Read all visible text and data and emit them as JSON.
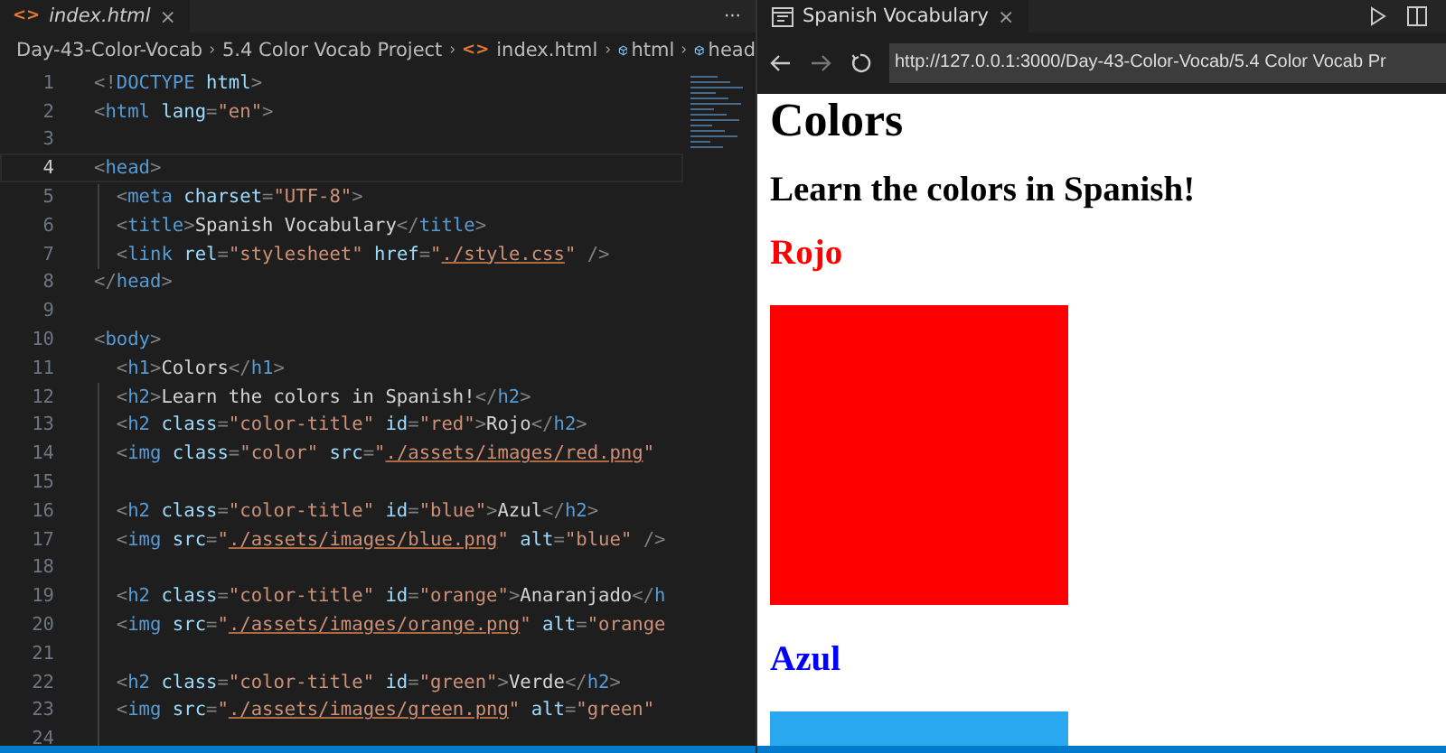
{
  "editor": {
    "tab": {
      "label": "index.html",
      "icon": "<>",
      "close": "×"
    },
    "more": "···",
    "breadcrumbs": [
      {
        "label": "Day-43-Color-Vocab",
        "kind": "folder"
      },
      {
        "label": "5.4 Color Vocab Project",
        "kind": "folder"
      },
      {
        "label": "index.html",
        "kind": "file"
      },
      {
        "label": "html",
        "kind": "element"
      },
      {
        "label": "head",
        "kind": "element"
      }
    ],
    "lines": [
      {
        "num": "1",
        "current": false,
        "tokens": [
          {
            "kind": "punct",
            "t": "<!"
          },
          {
            "kind": "tag",
            "t": "DOCTYPE"
          },
          {
            "kind": "attr",
            "t": " html"
          },
          {
            "kind": "punct",
            "t": ">"
          }
        ]
      },
      {
        "num": "2",
        "current": false,
        "tokens": [
          {
            "kind": "punct",
            "t": "<"
          },
          {
            "kind": "tag",
            "t": "html"
          },
          {
            "kind": "attr",
            "t": " lang"
          },
          {
            "kind": "punct",
            "t": "="
          },
          {
            "kind": "str",
            "t": "\"en\""
          },
          {
            "kind": "punct",
            "t": ">"
          }
        ]
      },
      {
        "num": "3",
        "current": false
      },
      {
        "num": "4",
        "current": true,
        "tokens": [
          {
            "kind": "punct",
            "t": "<"
          },
          {
            "kind": "tag",
            "t": "head"
          },
          {
            "kind": "punct",
            "t": ">"
          }
        ]
      },
      {
        "num": "5",
        "current": false,
        "tokens": [
          {
            "kind": "punct",
            "t": "  <"
          },
          {
            "kind": "tag",
            "t": "meta"
          },
          {
            "kind": "attr",
            "t": " charset"
          },
          {
            "kind": "punct",
            "t": "="
          },
          {
            "kind": "str",
            "t": "\"UTF-8\""
          },
          {
            "kind": "punct",
            "t": ">"
          }
        ]
      },
      {
        "num": "6",
        "current": false,
        "tokens": [
          {
            "kind": "punct",
            "t": "  <"
          },
          {
            "kind": "tag",
            "t": "title"
          },
          {
            "kind": "punct",
            "t": ">"
          },
          {
            "kind": "text",
            "t": "Spanish Vocabulary"
          },
          {
            "kind": "punct",
            "t": "</"
          },
          {
            "kind": "tag",
            "t": "title"
          },
          {
            "kind": "punct",
            "t": ">"
          }
        ]
      },
      {
        "num": "7",
        "current": false,
        "tokens": [
          {
            "kind": "punct",
            "t": "  <"
          },
          {
            "kind": "tag",
            "t": "link"
          },
          {
            "kind": "attr",
            "t": " rel"
          },
          {
            "kind": "punct",
            "t": "="
          },
          {
            "kind": "str",
            "t": "\"stylesheet\""
          },
          {
            "kind": "attr",
            "t": " href"
          },
          {
            "kind": "punct",
            "t": "="
          },
          {
            "kind": "str",
            "t": "\""
          },
          {
            "kind": "link",
            "t": "./style.css"
          },
          {
            "kind": "str",
            "t": "\""
          },
          {
            "kind": "punct",
            "t": " />"
          }
        ]
      },
      {
        "num": "8",
        "current": false,
        "tokens": [
          {
            "kind": "punct",
            "t": "</"
          },
          {
            "kind": "tag",
            "t": "head"
          },
          {
            "kind": "punct",
            "t": ">"
          }
        ]
      },
      {
        "num": "9",
        "current": false
      },
      {
        "num": "10",
        "current": false,
        "tokens": [
          {
            "kind": "punct",
            "t": "<"
          },
          {
            "kind": "tag",
            "t": "body"
          },
          {
            "kind": "punct",
            "t": ">"
          }
        ]
      },
      {
        "num": "11",
        "current": false,
        "tokens": [
          {
            "kind": "punct",
            "t": "  <"
          },
          {
            "kind": "tag",
            "t": "h1"
          },
          {
            "kind": "punct",
            "t": ">"
          },
          {
            "kind": "text",
            "t": "Colors"
          },
          {
            "kind": "punct",
            "t": "</"
          },
          {
            "kind": "tag",
            "t": "h1"
          },
          {
            "kind": "punct",
            "t": ">"
          }
        ]
      },
      {
        "num": "12",
        "current": false,
        "tokens": [
          {
            "kind": "punct",
            "t": "  <"
          },
          {
            "kind": "tag",
            "t": "h2"
          },
          {
            "kind": "punct",
            "t": ">"
          },
          {
            "kind": "text",
            "t": "Learn the colors in Spanish!"
          },
          {
            "kind": "punct",
            "t": "</"
          },
          {
            "kind": "tag",
            "t": "h2"
          },
          {
            "kind": "punct",
            "t": ">"
          }
        ]
      },
      {
        "num": "13",
        "current": false,
        "tokens": [
          {
            "kind": "punct",
            "t": "  <"
          },
          {
            "kind": "tag",
            "t": "h2"
          },
          {
            "kind": "attr",
            "t": " class"
          },
          {
            "kind": "punct",
            "t": "="
          },
          {
            "kind": "str",
            "t": "\"color-title\""
          },
          {
            "kind": "attr",
            "t": " id"
          },
          {
            "kind": "punct",
            "t": "="
          },
          {
            "kind": "str",
            "t": "\"red\""
          },
          {
            "kind": "punct",
            "t": ">"
          },
          {
            "kind": "text",
            "t": "Rojo"
          },
          {
            "kind": "punct",
            "t": "</"
          },
          {
            "kind": "tag",
            "t": "h2"
          },
          {
            "kind": "punct",
            "t": ">"
          }
        ]
      },
      {
        "num": "14",
        "current": false,
        "tokens": [
          {
            "kind": "punct",
            "t": "  <"
          },
          {
            "kind": "tag",
            "t": "img"
          },
          {
            "kind": "attr",
            "t": " class"
          },
          {
            "kind": "punct",
            "t": "="
          },
          {
            "kind": "str",
            "t": "\"color\""
          },
          {
            "kind": "attr",
            "t": " src"
          },
          {
            "kind": "punct",
            "t": "="
          },
          {
            "kind": "str",
            "t": "\""
          },
          {
            "kind": "link",
            "t": "./assets/images/red.png"
          },
          {
            "kind": "str",
            "t": "\""
          }
        ]
      },
      {
        "num": "15",
        "current": false
      },
      {
        "num": "16",
        "current": false,
        "tokens": [
          {
            "kind": "punct",
            "t": "  <"
          },
          {
            "kind": "tag",
            "t": "h2"
          },
          {
            "kind": "attr",
            "t": " class"
          },
          {
            "kind": "punct",
            "t": "="
          },
          {
            "kind": "str",
            "t": "\"color-title\""
          },
          {
            "kind": "attr",
            "t": " id"
          },
          {
            "kind": "punct",
            "t": "="
          },
          {
            "kind": "str",
            "t": "\"blue\""
          },
          {
            "kind": "punct",
            "t": ">"
          },
          {
            "kind": "text",
            "t": "Azul"
          },
          {
            "kind": "punct",
            "t": "</"
          },
          {
            "kind": "tag",
            "t": "h2"
          },
          {
            "kind": "punct",
            "t": ">"
          }
        ]
      },
      {
        "num": "17",
        "current": false,
        "tokens": [
          {
            "kind": "punct",
            "t": "  <"
          },
          {
            "kind": "tag",
            "t": "img"
          },
          {
            "kind": "attr",
            "t": " src"
          },
          {
            "kind": "punct",
            "t": "="
          },
          {
            "kind": "str",
            "t": "\""
          },
          {
            "kind": "link",
            "t": "./assets/images/blue.png"
          },
          {
            "kind": "str",
            "t": "\""
          },
          {
            "kind": "attr",
            "t": " alt"
          },
          {
            "kind": "punct",
            "t": "="
          },
          {
            "kind": "str",
            "t": "\"blue\""
          },
          {
            "kind": "punct",
            "t": " />"
          }
        ]
      },
      {
        "num": "18",
        "current": false
      },
      {
        "num": "19",
        "current": false,
        "tokens": [
          {
            "kind": "punct",
            "t": "  <"
          },
          {
            "kind": "tag",
            "t": "h2"
          },
          {
            "kind": "attr",
            "t": " class"
          },
          {
            "kind": "punct",
            "t": "="
          },
          {
            "kind": "str",
            "t": "\"color-title\""
          },
          {
            "kind": "attr",
            "t": " id"
          },
          {
            "kind": "punct",
            "t": "="
          },
          {
            "kind": "str",
            "t": "\"orange\""
          },
          {
            "kind": "punct",
            "t": ">"
          },
          {
            "kind": "text",
            "t": "Anaranjado"
          },
          {
            "kind": "punct",
            "t": "</"
          },
          {
            "kind": "tag",
            "t": "h"
          }
        ]
      },
      {
        "num": "20",
        "current": false,
        "tokens": [
          {
            "kind": "punct",
            "t": "  <"
          },
          {
            "kind": "tag",
            "t": "img"
          },
          {
            "kind": "attr",
            "t": " src"
          },
          {
            "kind": "punct",
            "t": "="
          },
          {
            "kind": "str",
            "t": "\""
          },
          {
            "kind": "link",
            "t": "./assets/images/orange.png"
          },
          {
            "kind": "str",
            "t": "\""
          },
          {
            "kind": "attr",
            "t": " alt"
          },
          {
            "kind": "punct",
            "t": "="
          },
          {
            "kind": "str",
            "t": "\"orange"
          }
        ]
      },
      {
        "num": "21",
        "current": false
      },
      {
        "num": "22",
        "current": false,
        "tokens": [
          {
            "kind": "punct",
            "t": "  <"
          },
          {
            "kind": "tag",
            "t": "h2"
          },
          {
            "kind": "attr",
            "t": " class"
          },
          {
            "kind": "punct",
            "t": "="
          },
          {
            "kind": "str",
            "t": "\"color-title\""
          },
          {
            "kind": "attr",
            "t": " id"
          },
          {
            "kind": "punct",
            "t": "="
          },
          {
            "kind": "str",
            "t": "\"green\""
          },
          {
            "kind": "punct",
            "t": ">"
          },
          {
            "kind": "text",
            "t": "Verde"
          },
          {
            "kind": "punct",
            "t": "</"
          },
          {
            "kind": "tag",
            "t": "h2"
          },
          {
            "kind": "punct",
            "t": ">"
          }
        ]
      },
      {
        "num": "23",
        "current": false,
        "tokens": [
          {
            "kind": "punct",
            "t": "  <"
          },
          {
            "kind": "tag",
            "t": "img"
          },
          {
            "kind": "attr",
            "t": " src"
          },
          {
            "kind": "punct",
            "t": "="
          },
          {
            "kind": "str",
            "t": "\""
          },
          {
            "kind": "link",
            "t": "./assets/images/green.png"
          },
          {
            "kind": "str",
            "t": "\""
          },
          {
            "kind": "attr",
            "t": " alt"
          },
          {
            "kind": "punct",
            "t": "="
          },
          {
            "kind": "str",
            "t": "\"green\""
          }
        ]
      },
      {
        "num": "24",
        "current": false
      }
    ]
  },
  "preview": {
    "tab": {
      "label": "Spanish Vocabulary",
      "close": "×"
    },
    "url": "http://127.0.0.1:3000/Day-43-Color-Vocab/5.4 Color Vocab Pr",
    "page": [
      {
        "kind": "h1",
        "text": "Colors"
      },
      {
        "kind": "h2",
        "text": "Learn the colors in Spanish!"
      },
      {
        "kind": "color-title",
        "text": "Rojo",
        "color": "#ff0000"
      },
      {
        "kind": "swatch",
        "color": "#ff0000"
      },
      {
        "kind": "color-title",
        "text": "Azul",
        "color": "#0000ff"
      },
      {
        "kind": "swatch",
        "color": "#29a8f0"
      }
    ]
  }
}
